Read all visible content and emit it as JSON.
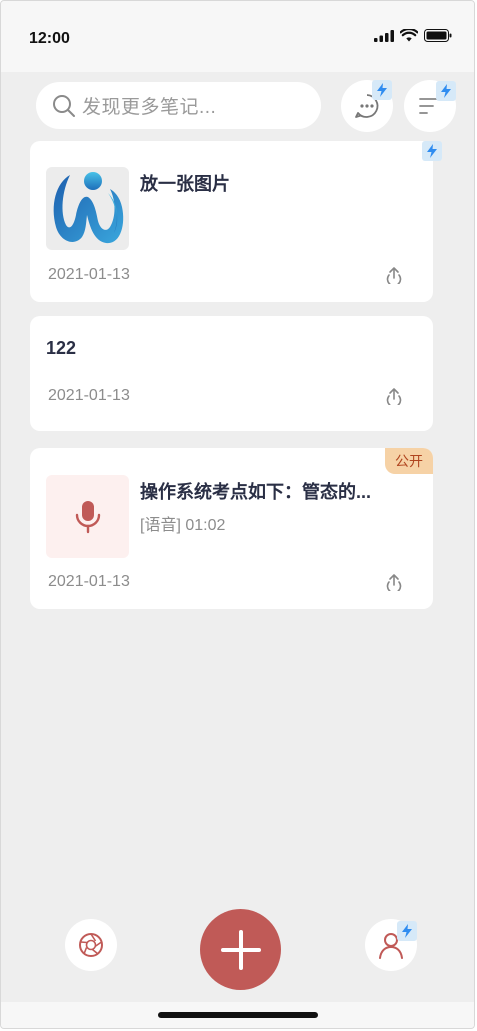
{
  "status_bar": {
    "time": "12:00"
  },
  "search": {
    "placeholder": "发现更多笔记..."
  },
  "notes": [
    {
      "title": "放一张图片",
      "date": "2021-01-13"
    },
    {
      "title": "122",
      "date": "2021-01-13"
    },
    {
      "title": "操作系统考点如下：管态的...",
      "subtitle": "[语音] 01:02",
      "date": "2021-01-13",
      "tag": "公开"
    }
  ],
  "colors": {
    "accent": "#c05a57",
    "background": "#eeeeee",
    "public_tag_bg": "#f6d2a6",
    "bolt_badge": "#d6e9f8",
    "bolt": "#2f8cf0"
  }
}
